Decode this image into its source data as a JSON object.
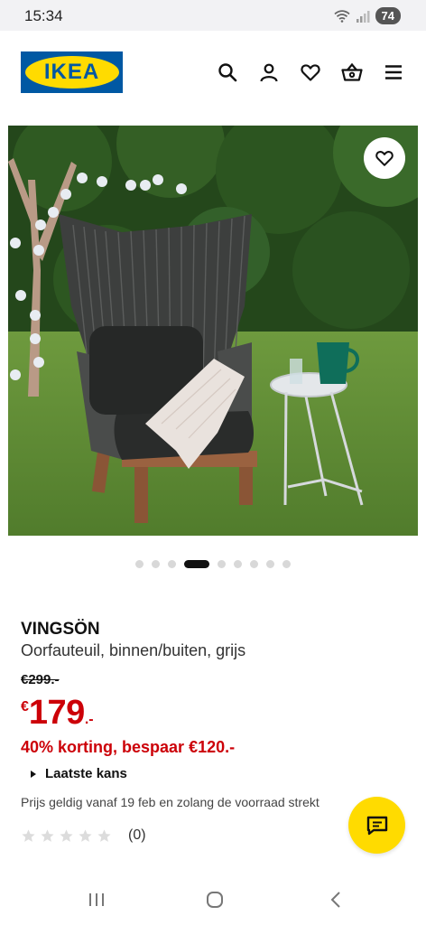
{
  "status_bar": {
    "time": "15:34",
    "battery": "74",
    "icons": [
      "wifi-icon",
      "signal-icon"
    ]
  },
  "header": {
    "logo_text": "IKEA",
    "icons": [
      "search-icon",
      "account-icon",
      "wishlist-icon",
      "basket-icon",
      "menu-icon"
    ],
    "brand_blue": "#0058a3",
    "brand_yellow": "#ffdb00"
  },
  "gallery": {
    "total_images": 9,
    "active_index": 3,
    "favorite_icon": "heart-outline-icon"
  },
  "product": {
    "name": "VINGSÖN",
    "description": "Oorfauteuil, binnen/buiten, grijs",
    "old_price": "€299.-",
    "price_currency": "€",
    "price_amount": "179",
    "price_suffix": ".-",
    "discount_text": "40% korting, bespaar €120.-",
    "last_chance": "Laatste kans",
    "validity": "Prijs geldig vanaf 19 feb en zolang de voorraad strekt",
    "rating_stars": 0,
    "rating_max": 5,
    "rating_count": "(0)",
    "price_color": "#cc0008"
  },
  "chat": {
    "icon": "chat-icon"
  },
  "nav_bar": {
    "icons": [
      "recent-apps-icon",
      "home-icon",
      "back-icon"
    ]
  }
}
